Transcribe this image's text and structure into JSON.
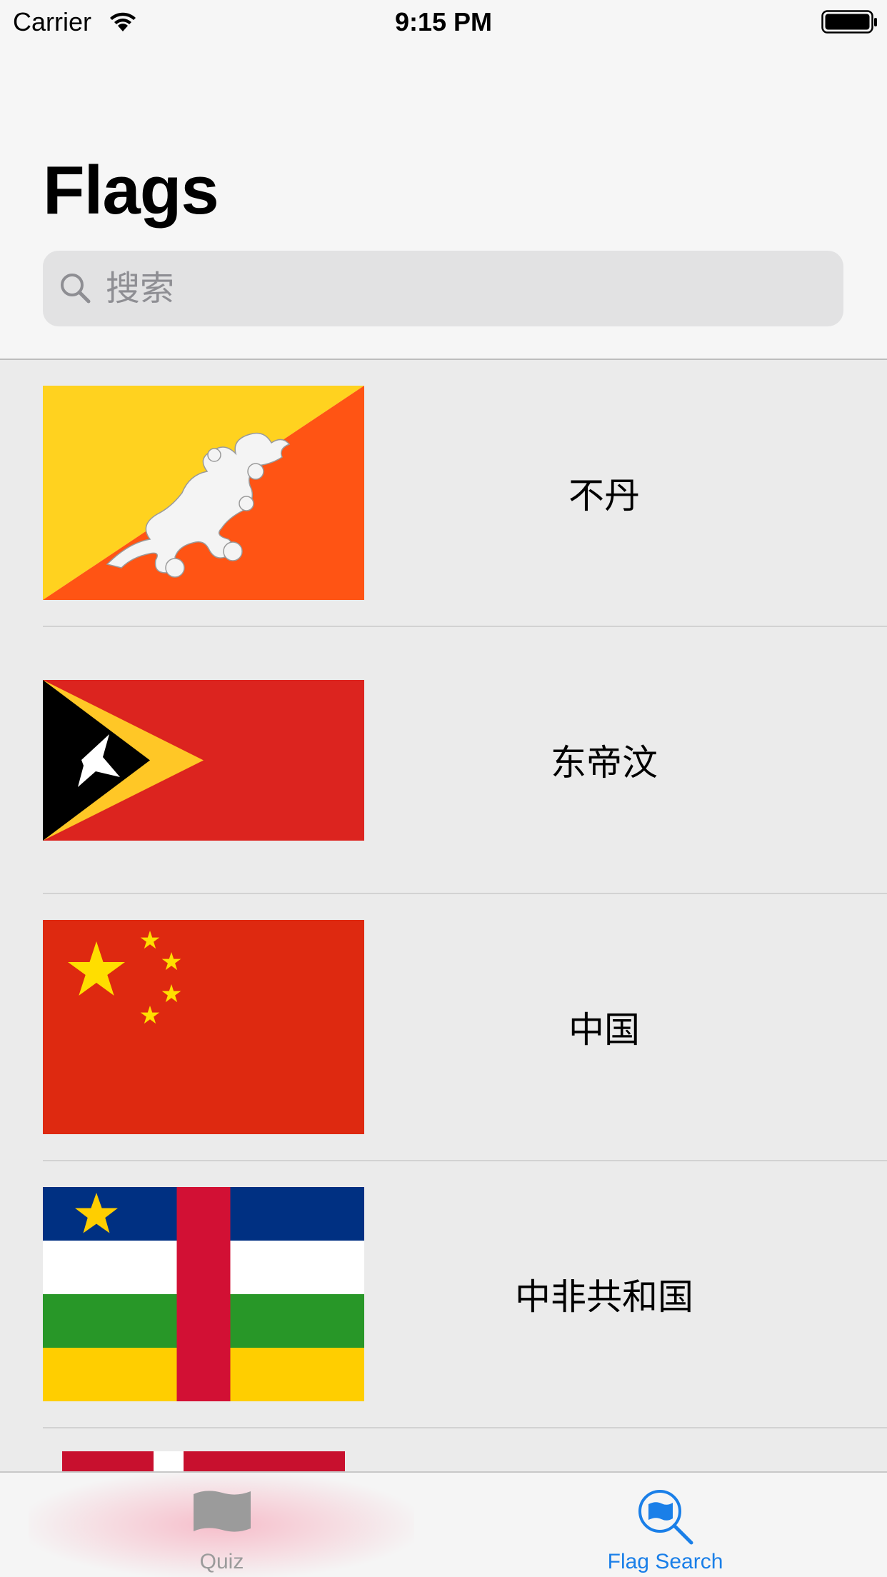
{
  "status_bar": {
    "carrier": "Carrier",
    "time": "9:15 PM",
    "wifi_icon": "wifi-icon",
    "battery_icon": "battery-icon"
  },
  "header": {
    "title": "Flags"
  },
  "search": {
    "placeholder": "搜索",
    "icon": "search-icon"
  },
  "flags": [
    {
      "name": "不丹",
      "flag": "bhutan-flag"
    },
    {
      "name": "东帝汶",
      "flag": "east-timor-flag"
    },
    {
      "name": "中国",
      "flag": "china-flag"
    },
    {
      "name": "中非共和国",
      "flag": "central-african-republic-flag"
    }
  ],
  "partial_flag": "denmark-flag",
  "tab_bar": {
    "tabs": [
      {
        "label": "Quiz",
        "icon": "flag-icon",
        "selected": false
      },
      {
        "label": "Flag Search",
        "icon": "flag-search-icon",
        "selected": true
      }
    ],
    "selected_color": "#1a7fe8",
    "unselected_color": "#9b9b9b"
  }
}
